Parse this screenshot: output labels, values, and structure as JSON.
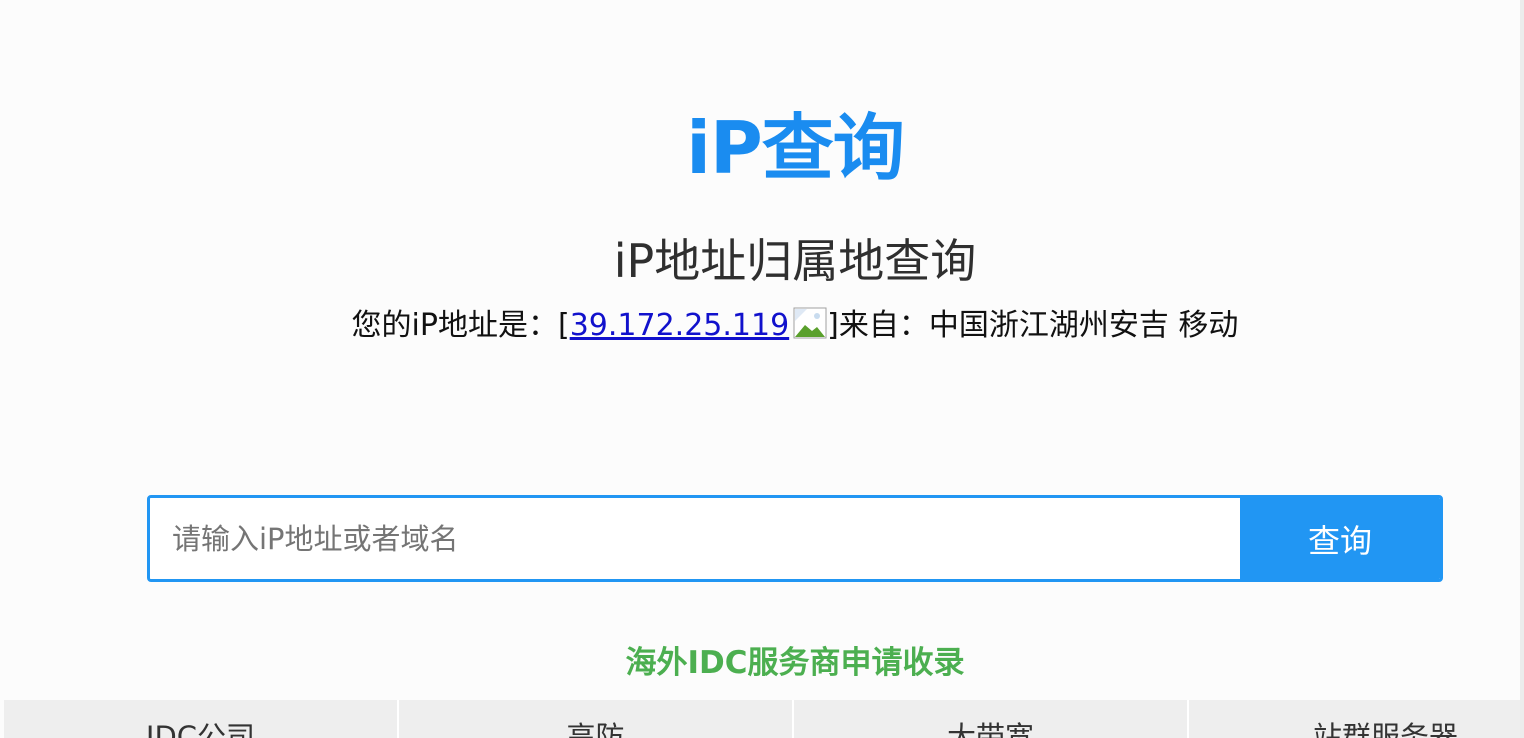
{
  "logo": {
    "text": "iP查询"
  },
  "page_title": "iP地址归属地查询",
  "ip_info": {
    "prefix": "您的iP地址是：[",
    "ip": "39.172.25.119",
    "bracket_close": "]",
    "from_label": "来自：",
    "location": "中国浙江湖州安吉 移动"
  },
  "search": {
    "placeholder": "请输入iP地址或者域名",
    "value": "",
    "button_label": "查询"
  },
  "idc_link": "海外IDC服务商申请收录",
  "idc_table": {
    "columns": [
      "IDC公司",
      "高防",
      "大带宽",
      "站群服务器"
    ]
  },
  "colors": {
    "accent": "#1a8cf0",
    "button": "#2196f3",
    "green": "#4caf50",
    "link": "#1111cc"
  }
}
